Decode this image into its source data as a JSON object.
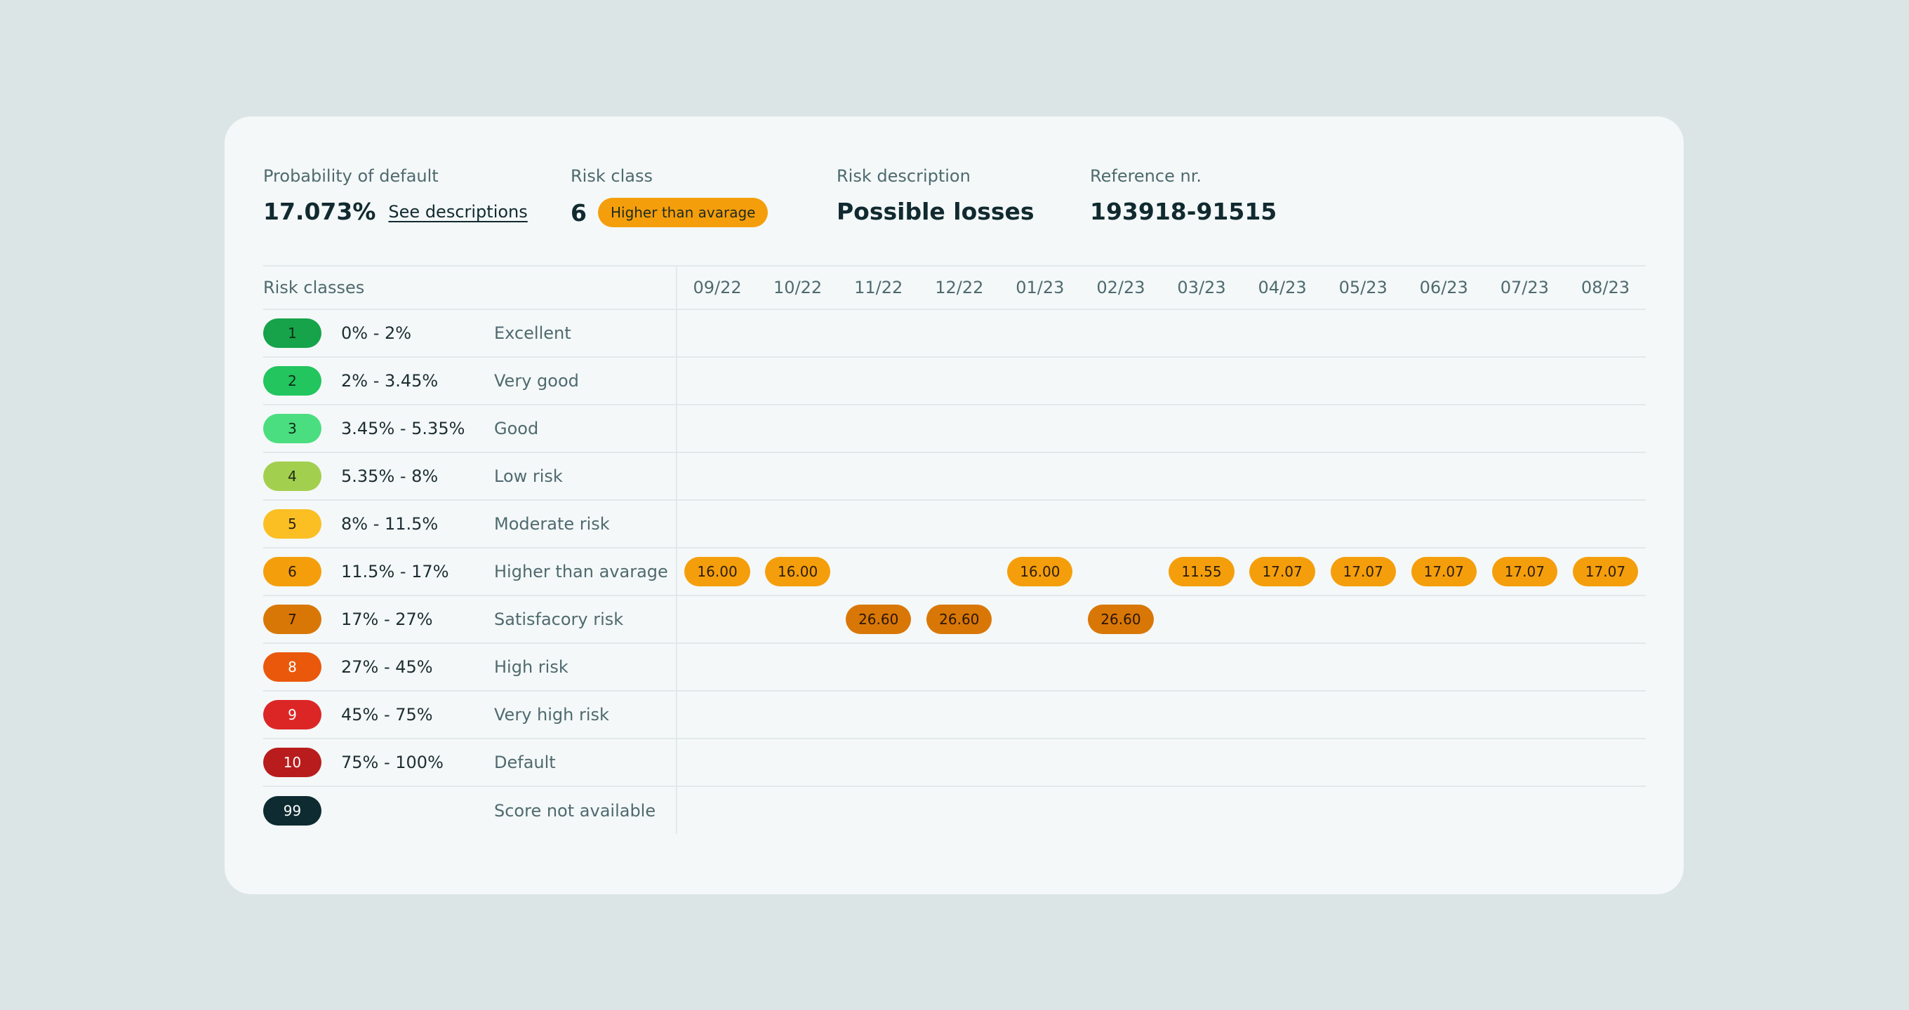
{
  "summary": {
    "probability_label": "Probability of default",
    "probability_value": "17.073%",
    "see_link": "See descriptions",
    "risk_class_label": "Risk class",
    "risk_class_value": "6",
    "risk_class_badge": "Higher than avarage",
    "risk_description_label": "Risk description",
    "risk_description_value": "Possible losses",
    "reference_label": "Reference nr.",
    "reference_value": "193918-91515"
  },
  "table": {
    "header": "Risk classes",
    "months": [
      "09/22",
      "10/22",
      "11/22",
      "12/22",
      "01/23",
      "02/23",
      "03/23",
      "04/23",
      "05/23",
      "06/23",
      "07/23",
      "08/23"
    ],
    "classes": [
      {
        "id": "1",
        "range": "0% - 2%",
        "description": "Excellent",
        "color": "#16a34a",
        "text_color": "#0f2a16",
        "values": [
          "",
          "",
          "",
          "",
          "",
          "",
          "",
          "",
          "",
          "",
          "",
          ""
        ]
      },
      {
        "id": "2",
        "range": "2% - 3.45%",
        "description": "Very good",
        "color": "#22c55e",
        "text_color": "#0f2a16",
        "values": [
          "",
          "",
          "",
          "",
          "",
          "",
          "",
          "",
          "",
          "",
          "",
          ""
        ]
      },
      {
        "id": "3",
        "range": "3.45% - 5.35%",
        "description": "Good",
        "color": "#4ade80",
        "text_color": "#0f2a16",
        "values": [
          "",
          "",
          "",
          "",
          "",
          "",
          "",
          "",
          "",
          "",
          "",
          ""
        ]
      },
      {
        "id": "4",
        "range": "5.35% - 8%",
        "description": "Low risk",
        "color": "#a3cf4f",
        "text_color": "#1b2a10",
        "values": [
          "",
          "",
          "",
          "",
          "",
          "",
          "",
          "",
          "",
          "",
          "",
          ""
        ]
      },
      {
        "id": "5",
        "range": "8% - 11.5%",
        "description": "Moderate risk",
        "color": "#fbbf24",
        "text_color": "#2a2110",
        "values": [
          "",
          "",
          "",
          "",
          "",
          "",
          "",
          "",
          "",
          "",
          "",
          ""
        ]
      },
      {
        "id": "6",
        "range": "11.5% - 17%",
        "description": "Higher than avarage",
        "color": "#f59e0b",
        "text_color": "#2a1d10",
        "values": [
          "16.00",
          "16.00",
          "",
          "",
          "16.00",
          "",
          "11.55",
          "17.07",
          "17.07",
          "17.07",
          "17.07",
          "17.07"
        ]
      },
      {
        "id": "7",
        "range": "17% - 27%",
        "description": "Satisfacory risk",
        "color": "#d97706",
        "text_color": "#2a1608",
        "values": [
          "",
          "",
          "26.60",
          "26.60",
          "",
          "26.60",
          "",
          "",
          "",
          "",
          "",
          ""
        ]
      },
      {
        "id": "8",
        "range": "27% - 45%",
        "description": "High risk",
        "color": "#ea580c",
        "text_color": "#ffffff",
        "values": [
          "",
          "",
          "",
          "",
          "",
          "",
          "",
          "",
          "",
          "",
          "",
          ""
        ]
      },
      {
        "id": "9",
        "range": "45% - 75%",
        "description": "Very high risk",
        "color": "#dc2626",
        "text_color": "#ffffff",
        "values": [
          "",
          "",
          "",
          "",
          "",
          "",
          "",
          "",
          "",
          "",
          "",
          ""
        ]
      },
      {
        "id": "10",
        "range": "75% - 100%",
        "description": "Default",
        "color": "#b91c1c",
        "text_color": "#ffffff",
        "values": [
          "",
          "",
          "",
          "",
          "",
          "",
          "",
          "",
          "",
          "",
          "",
          ""
        ]
      },
      {
        "id": "99",
        "range": "",
        "description": "Score not available",
        "color": "#0d2b30",
        "text_color": "#ffffff",
        "values": [
          "",
          "",
          "",
          "",
          "",
          "",
          "",
          "",
          "",
          "",
          "",
          ""
        ]
      }
    ]
  },
  "colors": {
    "background": "#dbe5e6",
    "card": "#f4f8f8",
    "summary_badge": "#f59e0b"
  }
}
